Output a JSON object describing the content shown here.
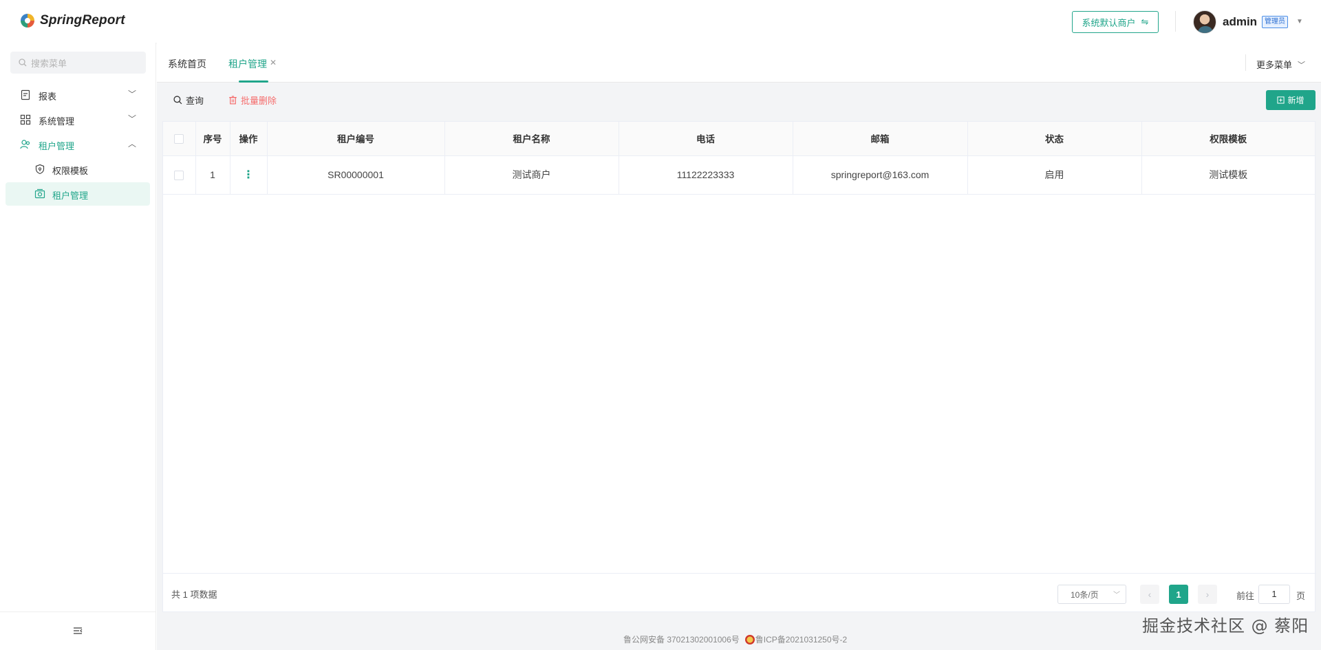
{
  "app": {
    "name": "SpringReport",
    "accent": "#20a58a"
  },
  "header": {
    "tenant_switch_label": "系统默认商户",
    "username": "admin",
    "role_badge": "管理员"
  },
  "sidebar": {
    "search_placeholder": "搜索菜单",
    "items": [
      {
        "label": "报表",
        "icon": "report-icon",
        "expanded": false
      },
      {
        "label": "系统管理",
        "icon": "grid-icon",
        "expanded": false
      },
      {
        "label": "租户管理",
        "icon": "users-icon",
        "expanded": true,
        "children": [
          {
            "label": "权限模板",
            "icon": "shield-icon"
          },
          {
            "label": "租户管理",
            "icon": "tenant-icon",
            "selected": true
          }
        ]
      }
    ]
  },
  "tabs": [
    {
      "label": "系统首页",
      "active": false
    },
    {
      "label": "租户管理",
      "active": true,
      "closable": true
    }
  ],
  "more_menu_label": "更多菜单",
  "toolbar": {
    "search_label": "查询",
    "batch_delete_label": "批量删除",
    "add_label": "新增"
  },
  "table": {
    "columns": [
      "序号",
      "操作",
      "租户编号",
      "租户名称",
      "电话",
      "邮箱",
      "状态",
      "权限模板"
    ],
    "rows": [
      {
        "index": "1",
        "code": "SR00000001",
        "name": "测试商户",
        "phone": "11122223333",
        "email": "springreport@163.com",
        "status": "启用",
        "template": "测试模板"
      }
    ]
  },
  "pagination": {
    "total_text": "共 1 项数据",
    "page_size": "10条/页",
    "current_page": "1",
    "goto_prefix": "前往",
    "goto_value": "1",
    "goto_suffix": "页"
  },
  "footer": {
    "police_record": "鲁公网安备 37021302001006号",
    "icp_record": "鲁ICP备2021031250号-2"
  },
  "watermark": "掘金技术社区 @ 蔡阳"
}
